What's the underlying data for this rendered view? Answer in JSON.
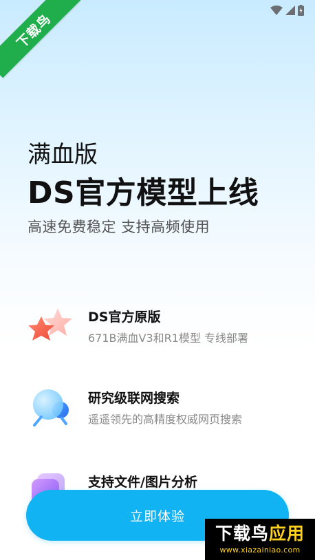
{
  "corner_watermark": {
    "text": "下载鸟"
  },
  "status_bar": {
    "icons": [
      "wifi-icon",
      "cell-signal-icon",
      "battery-charging-icon"
    ]
  },
  "hero": {
    "subtitle_top": "满血版",
    "title": "DS官方模型上线",
    "tagline": "高速免费稳定 支持高频使用"
  },
  "features": [
    {
      "icon": "star-icon",
      "title": "DS官方原版",
      "description": "671B满血V3和R1模型 专线部署"
    },
    {
      "icon": "search-globe-icon",
      "title": "研究级联网搜索",
      "description": "遥遥领先的高精度权威网页搜索"
    },
    {
      "icon": "file-image-icon",
      "title": "支持文件/图片分析",
      "description": ""
    }
  ],
  "cta": {
    "label": "立即体验",
    "color": "#11b3f2"
  },
  "bottom_watermark": {
    "title_part1": "下载鸟",
    "title_part2": "应用",
    "url": "www.xiazainiao.com"
  },
  "colors": {
    "accent": "#11b3f2",
    "ribbon": "#1fae4b",
    "watermark_yellow": "#ffd21f"
  }
}
